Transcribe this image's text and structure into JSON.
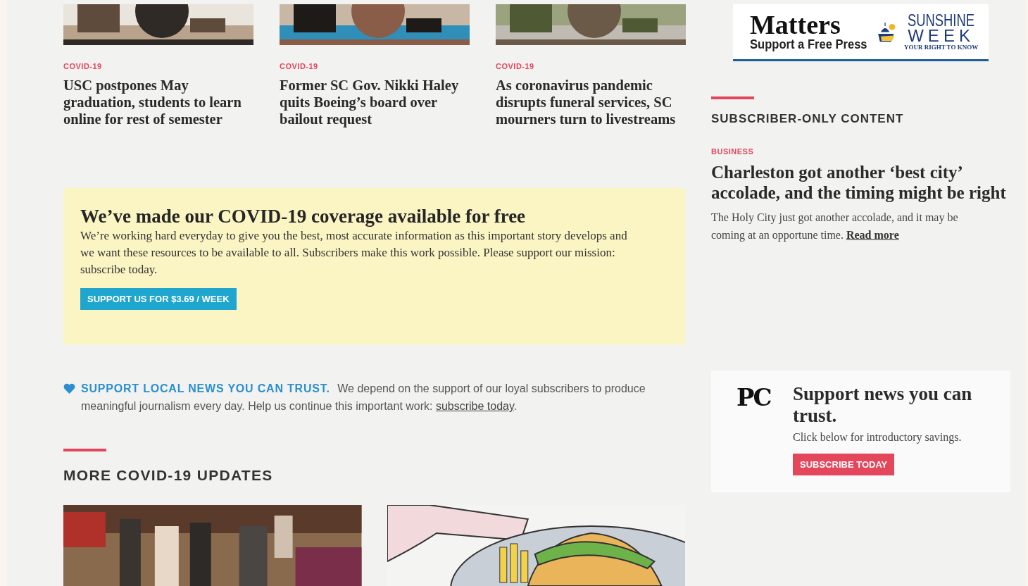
{
  "top_stories": [
    {
      "tag": "COVID-19",
      "headline": "USC postpones May graduation, students to learn online for rest of semester",
      "kind": "picture"
    },
    {
      "tag": "COVID-19",
      "headline": "Former SC Gov. Nikki Haley quits Boeing’s board over bailout request",
      "kind": "picture"
    },
    {
      "tag": "COVID-19",
      "headline": "As coronavirus pandemic disrupts funeral services, SC mourners turn to livestreams",
      "kind": "picture"
    }
  ],
  "covid_notice": {
    "title": "We’ve made our COVID-19 coverage available for free",
    "body": "We’re working hard everyday to give you the best, most accurate information as this important story develops and we want these resources to be available to all. Subscribers make this work possible. Please support our mission: subscribe today.",
    "button": "SUPPORT US FOR $3.69 / WEEK"
  },
  "support_note": {
    "lead": "SUPPORT LOCAL NEWS YOU CAN TRUST.",
    "text": "We depend on the support of our loyal subscribers to produce meaningful journalism every day. Help us continue this important work:",
    "link": "subscribe today",
    "tail": "."
  },
  "more_section": {
    "heading": "MORE COVID-19 UPDATES"
  },
  "ad_banner": {
    "headline": "Matters",
    "tagline": "Support a Free Press",
    "brand_top": "SUNSHINE",
    "brand_bottom": "WEEK",
    "slogan": "YOUR RIGHT TO KNOW"
  },
  "subscriber_section": {
    "heading": "SUBSCRIBER-ONLY CONTENT",
    "tag": "BUSINESS",
    "headline": "Charleston got another ‘best city’ accolade, and the timing might be right",
    "summary": "The Holy City just got another accolade, and it may be coming at an opportune time.",
    "link": "Read more"
  },
  "promo_card": {
    "logo": "PC",
    "title": "Support news you can trust.",
    "text": "Click below for introductory savings.",
    "button": "SUBSCRIBE TODAY"
  }
}
